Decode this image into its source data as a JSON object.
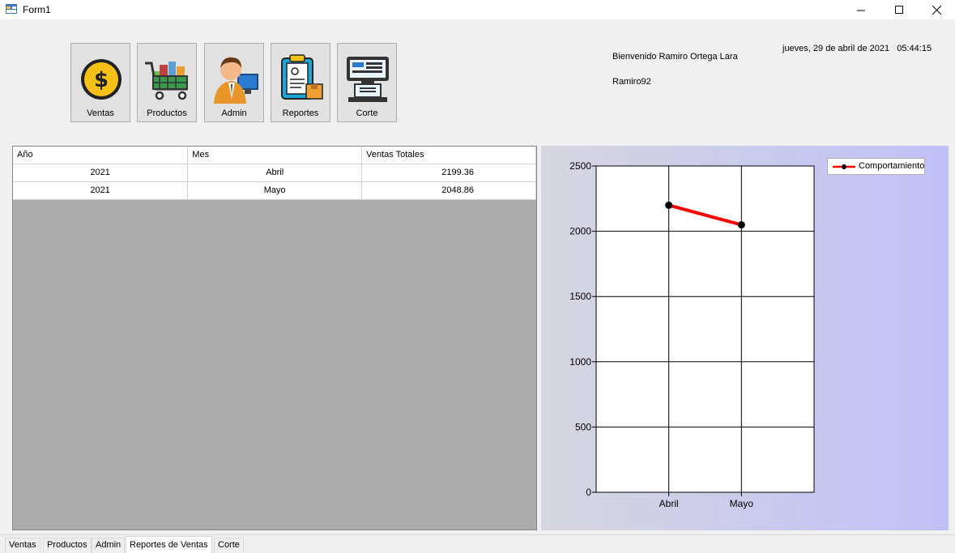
{
  "window": {
    "title": "Form1",
    "icon": "form-icon",
    "controls": [
      "minimize-icon",
      "maximize-icon",
      "close-icon"
    ]
  },
  "toolbar": [
    {
      "label": "Ventas",
      "icon": "dollar-coin-icon"
    },
    {
      "label": "Productos",
      "icon": "shopping-cart-icon"
    },
    {
      "label": "Admin",
      "icon": "admin-user-icon"
    },
    {
      "label": "Reportes",
      "icon": "clipboard-report-icon"
    },
    {
      "label": "Corte",
      "icon": "cash-register-icon"
    }
  ],
  "header": {
    "welcome": "Bienvenido Ramiro Ortega Lara",
    "username": "Ramiro92",
    "datetime": "jueves, 29 de abril de 2021   05:44:15"
  },
  "table": {
    "columns": [
      "Año",
      "Mes",
      "Ventas Totales"
    ],
    "rows": [
      [
        "2021",
        "Abril",
        "2199.36"
      ],
      [
        "2021",
        "Mayo",
        "2048.86"
      ]
    ]
  },
  "chart_data": {
    "type": "line",
    "categories": [
      "Abril",
      "Mayo"
    ],
    "series": [
      {
        "name": "Comportamiento",
        "values": [
          2199.36,
          2048.86
        ],
        "color": "#ff0000"
      }
    ],
    "ylim": [
      0,
      2500
    ],
    "yticks": [
      "0",
      "500",
      "1000",
      "1500",
      "2000",
      "2500"
    ],
    "grid": true,
    "legend": "top-right",
    "xlabel": "",
    "ylabel": "",
    "title": ""
  },
  "tabs": [
    {
      "label": "Ventas",
      "active": false
    },
    {
      "label": "Productos",
      "active": false
    },
    {
      "label": "Admin",
      "active": false
    },
    {
      "label": "Reportes de Ventas",
      "active": true
    },
    {
      "label": "Corte",
      "active": false
    }
  ]
}
